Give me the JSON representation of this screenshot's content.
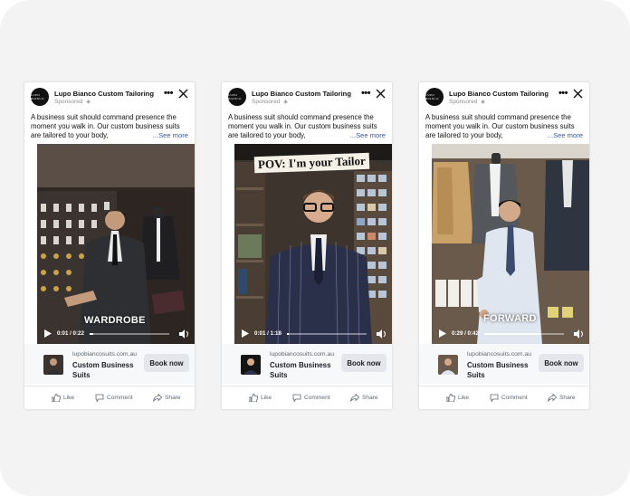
{
  "ads": [
    {
      "page_name": "Lupo Bianco Custom Tailoring",
      "sponsored": "Sponsored",
      "avatar_text": "LUPO BIANCO",
      "caption": "A business suit should command presence the moment you walk in. Our custom business suits are tailored to your body,",
      "see_more": "...See more",
      "video": {
        "overlay": "WARDROBE",
        "time": "0:01 / 0:22",
        "progress": 0.05
      },
      "cta": {
        "domain": "lupobiancosuits.com.au",
        "title": "Custom Business Suits",
        "button": "Book now"
      },
      "actions": {
        "like": "Like",
        "comment": "Comment",
        "share": "Share"
      }
    },
    {
      "page_name": "Lupo Bianco Custom Tailoring",
      "sponsored": "Sponsored",
      "avatar_text": "LUPO BIANCO",
      "caption": "A business suit should command presence the moment you walk in. Our custom business suits are tailored to your body,",
      "see_more": "...See more",
      "video": {
        "overlay": "POV: I'm your Tailor",
        "time": "0:01 / 1:18",
        "progress": 0.02
      },
      "cta": {
        "domain": "lupobiancosuits.com.au",
        "title": "Custom Business Suits",
        "button": "Book now"
      },
      "actions": {
        "like": "Like",
        "comment": "Comment",
        "share": "Share"
      }
    },
    {
      "page_name": "Lupo Bianco Custom Tailoring",
      "sponsored": "Sponsored",
      "avatar_text": "LUPO BIANCO",
      "caption": "A business suit should command presence the moment you walk in. Our custom business suits are tailored to your body,",
      "see_more": "...See more",
      "video": {
        "overlay": "FORWARD",
        "time": "0:29 / 0:42",
        "progress": 0.69
      },
      "cta": {
        "domain": "lupobiancosuits.com.au",
        "title": "Custom Business Suits",
        "button": "Book now"
      },
      "actions": {
        "like": "Like",
        "comment": "Comment",
        "share": "Share"
      }
    }
  ],
  "colors": {
    "link": "#385898",
    "muted": "#8a8d91",
    "button_bg": "#e4e6eb",
    "frame_bg": "#f3f3f3"
  },
  "icons": [
    "more-icon",
    "close-icon",
    "globe-icon",
    "play-icon",
    "volume-icon",
    "like-icon",
    "comment-icon",
    "share-icon"
  ]
}
